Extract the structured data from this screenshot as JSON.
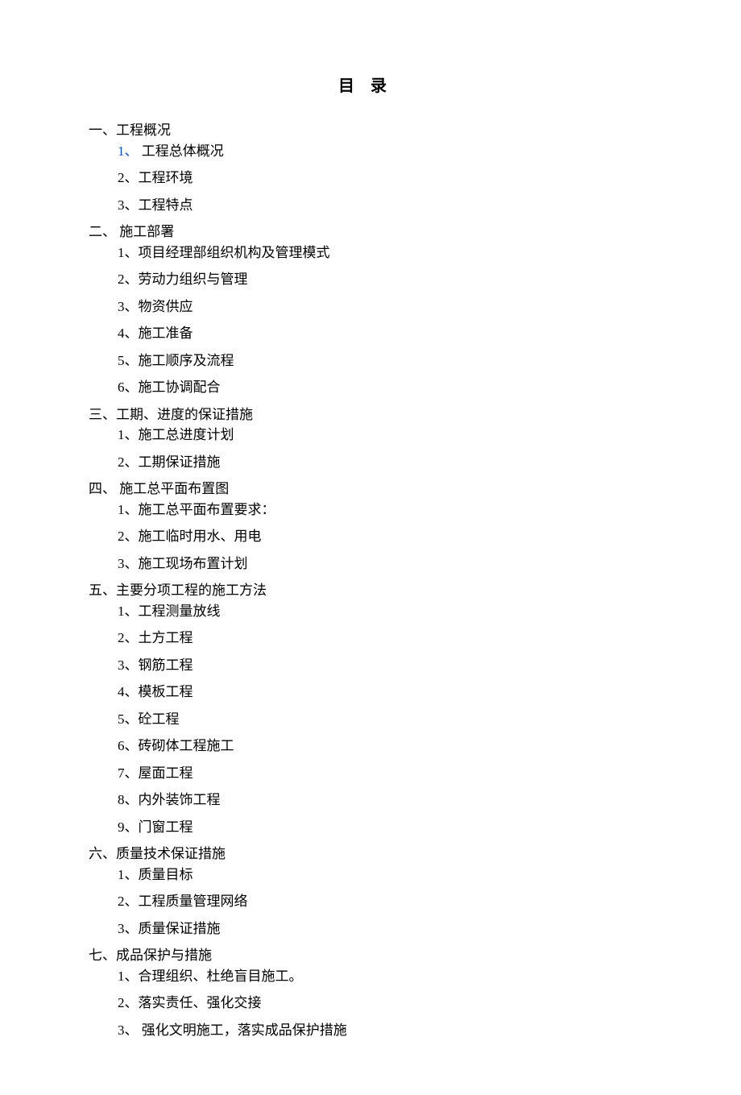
{
  "title": "目录",
  "sections": [
    {
      "heading": "一、工程概况",
      "items": [
        {
          "num": "1、",
          "label": " 工程总体概况",
          "link": true
        },
        {
          "num": "2、",
          "label": "工程环境"
        },
        {
          "num": "3、",
          "label": "工程特点"
        }
      ]
    },
    {
      "heading": "二、 施工部署",
      "items": [
        {
          "num": "1、",
          "label": "项目经理部组织机构及管理模式"
        },
        {
          "num": "2、",
          "label": "劳动力组织与管理"
        },
        {
          "num": "3、",
          "label": "物资供应"
        },
        {
          "num": "4、",
          "label": "施工准备"
        },
        {
          "num": "5、",
          "label": "施工顺序及流程"
        },
        {
          "num": "6、",
          "label": "施工协调配合"
        }
      ]
    },
    {
      "heading": "三、工期、进度的保证措施",
      "items": [
        {
          "num": "1、",
          "label": "施工总进度计划"
        },
        {
          "num": "2、",
          "label": "工期保证措施"
        }
      ]
    },
    {
      "heading": "四、 施工总平面布置图",
      "items": [
        {
          "num": "1、",
          "label": "施工总平面布置要求："
        },
        {
          "num": "2、",
          "label": "施工临时用水、用电"
        },
        {
          "num": "3、",
          "label": "施工现场布置计划"
        }
      ]
    },
    {
      "heading": "五、主要分项工程的施工方法",
      "items": [
        {
          "num": "1、",
          "label": "工程测量放线"
        },
        {
          "num": "2、",
          "label": "土方工程"
        },
        {
          "num": "3、",
          "label": "钢筋工程"
        },
        {
          "num": "4、",
          "label": "模板工程"
        },
        {
          "num": "5、",
          "label": "砼工程"
        },
        {
          "num": "6、",
          "label": "砖砌体工程施工"
        },
        {
          "num": "7、",
          "label": "屋面工程"
        },
        {
          "num": "8、",
          "label": "内外装饰工程"
        },
        {
          "num": "9、",
          "label": "门窗工程"
        }
      ]
    },
    {
      "heading": "六、质量技术保证措施",
      "items": [
        {
          "num": "1、",
          "label": "质量目标"
        },
        {
          "num": "2、",
          "label": "工程质量管理网络"
        },
        {
          "num": "3、",
          "label": "质量保证措施"
        }
      ]
    },
    {
      "heading": "七、成品保护与措施",
      "items": [
        {
          "num": "1、",
          "label": "合理组织、杜绝盲目施工。"
        },
        {
          "num": "2、",
          "label": "落实责任、强化交接"
        },
        {
          "num": "3、",
          "label": " 强化文明施工，落实成品保护措施"
        }
      ]
    }
  ]
}
